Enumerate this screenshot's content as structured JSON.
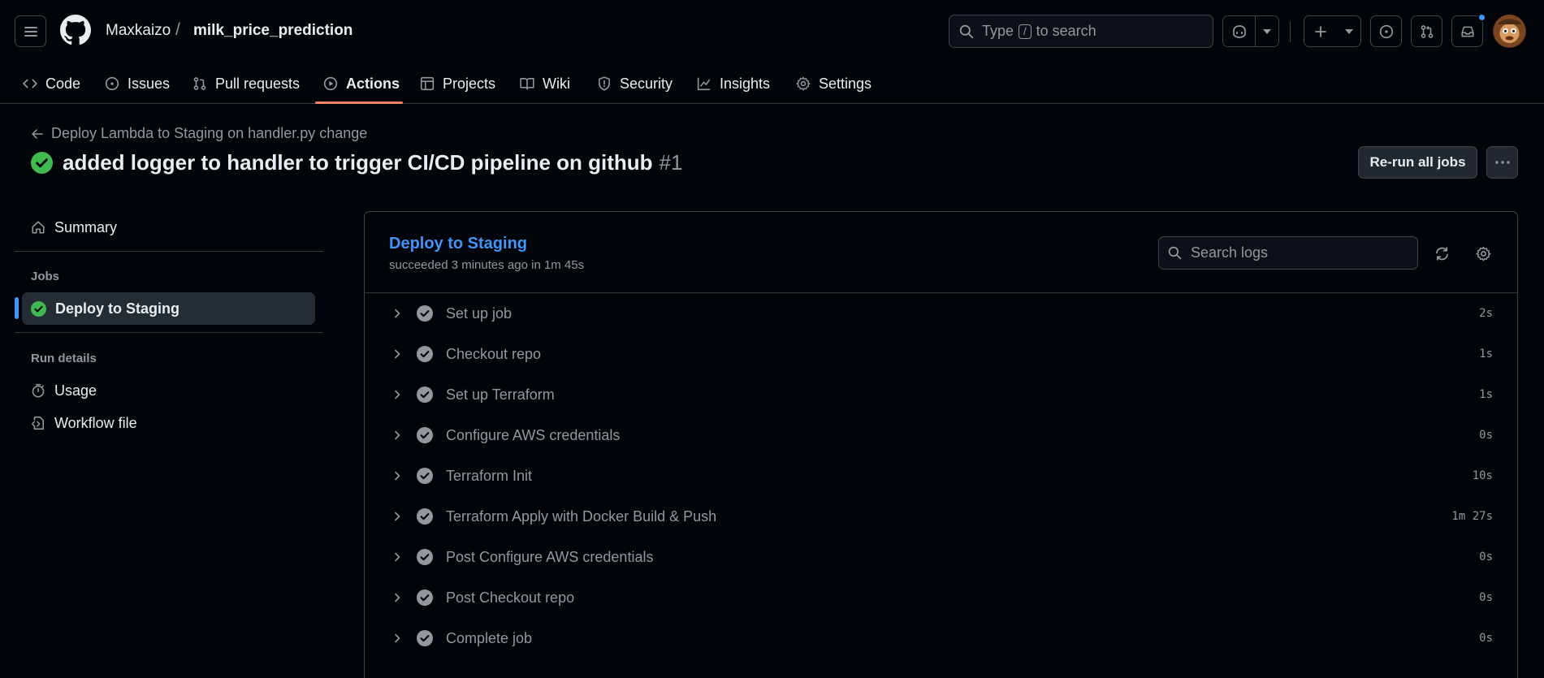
{
  "header": {
    "owner": "Maxkaizo",
    "separator": "/",
    "repo": "milk_price_prediction",
    "search": {
      "prefix": "Type",
      "key": "/",
      "suffix": "to search"
    },
    "accent_color": "#f78166",
    "notification_color": "#4493f8"
  },
  "tabs": [
    {
      "label": "Code",
      "icon": "code-icon"
    },
    {
      "label": "Issues",
      "icon": "issue-icon"
    },
    {
      "label": "Pull requests",
      "icon": "pull-request-icon"
    },
    {
      "label": "Actions",
      "icon": "play-icon",
      "active": true
    },
    {
      "label": "Projects",
      "icon": "table-icon"
    },
    {
      "label": "Wiki",
      "icon": "book-icon"
    },
    {
      "label": "Security",
      "icon": "shield-icon"
    },
    {
      "label": "Insights",
      "icon": "graph-icon"
    },
    {
      "label": "Settings",
      "icon": "gear-icon"
    }
  ],
  "run": {
    "back_label": "Deploy Lambda to Staging on handler.py change",
    "title": "added logger to handler to trigger CI/CD pipeline on github",
    "number": "#1",
    "status_color": "#3fb950",
    "rerun_label": "Re-run all jobs"
  },
  "sidebar": {
    "summary_label": "Summary",
    "jobs_heading": "Jobs",
    "job_label": "Deploy to Staging",
    "run_details_heading": "Run details",
    "usage_label": "Usage",
    "workflow_file_label": "Workflow file"
  },
  "job": {
    "name": "Deploy to Staging",
    "status": "succeeded 3 minutes ago in 1m 45s",
    "search_placeholder": "Search logs",
    "steps": [
      {
        "name": "Set up job",
        "duration": "2s"
      },
      {
        "name": "Checkout repo",
        "duration": "1s"
      },
      {
        "name": "Set up Terraform",
        "duration": "1s"
      },
      {
        "name": "Configure AWS credentials",
        "duration": "0s"
      },
      {
        "name": "Terraform Init",
        "duration": "10s"
      },
      {
        "name": "Terraform Apply with Docker Build & Push",
        "duration": "1m 27s"
      },
      {
        "name": "Post Configure AWS credentials",
        "duration": "0s"
      },
      {
        "name": "Post Checkout repo",
        "duration": "0s"
      },
      {
        "name": "Complete job",
        "duration": "0s"
      }
    ]
  }
}
